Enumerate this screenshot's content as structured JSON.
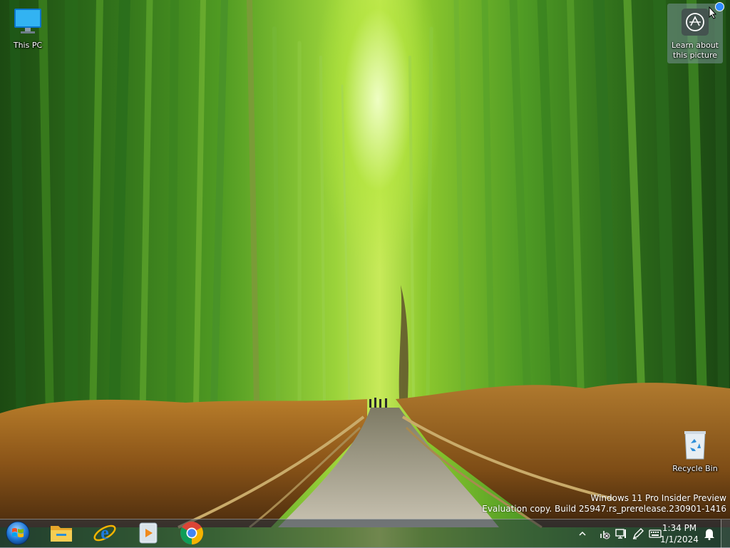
{
  "desktop": {
    "icons": [
      {
        "label": "This PC",
        "icon": "computer-monitor-icon"
      },
      {
        "label": "Recycle Bin",
        "icon": "recycle-bin-icon"
      }
    ],
    "learn_about_picture": {
      "label": "Learn about this picture",
      "icon": "camera-circle-icon"
    }
  },
  "watermark": {
    "line1": "Windows 11 Pro Insider Preview",
    "line2": "Evaluation copy. Build 25947.rs_prerelease.230901-1416"
  },
  "taskbar": {
    "pinned": [
      {
        "name": "Start",
        "icon": "windows-orb-icon"
      },
      {
        "name": "File Explorer",
        "icon": "folder-icon"
      },
      {
        "name": "Internet Explorer",
        "icon": "ie-icon"
      },
      {
        "name": "Media Player",
        "icon": "media-player-icon"
      },
      {
        "name": "Google Chrome",
        "icon": "chrome-icon"
      }
    ],
    "tray": {
      "icons": [
        "chevron-up-icon",
        "network-disconnected-icon",
        "display-icon",
        "pen-icon",
        "keyboard-icon"
      ],
      "clock": {
        "time": "1:34 PM",
        "date": "1/1/2024"
      },
      "notification_icon": "bell-icon"
    }
  },
  "colors": {
    "taskbar_bg": "#28344699",
    "start_orb": "#1e78d8",
    "folder": "#f3c34a",
    "chrome_red": "#db4437",
    "chrome_yellow": "#f4b400",
    "chrome_green": "#0f9d58",
    "chrome_blue": "#4285f4",
    "notification_dot": "#2f8bff"
  }
}
